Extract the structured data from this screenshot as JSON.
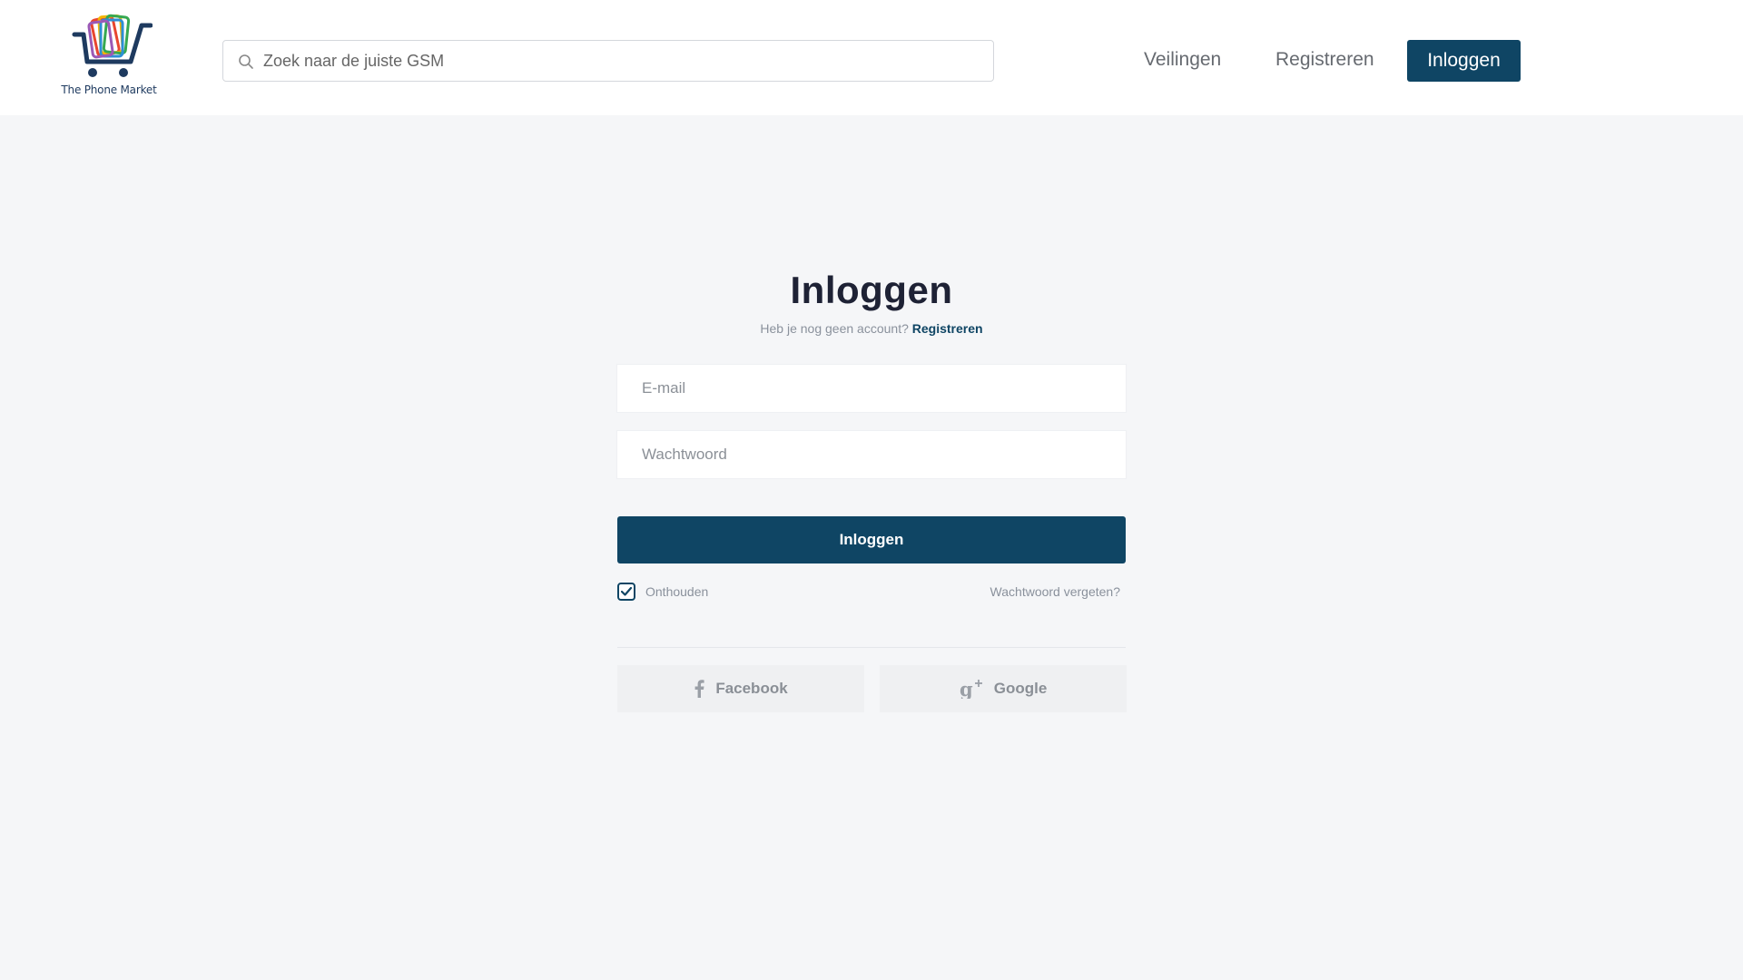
{
  "header": {
    "logo_text": "The Phone Market",
    "search_placeholder": "Zoek naar de juiste GSM",
    "nav": {
      "auctions": "Veilingen",
      "register": "Registreren",
      "login": "Inloggen"
    }
  },
  "login_form": {
    "title": "Inloggen",
    "no_account_text": "Heb je nog geen account?",
    "register_link": "Registreren",
    "email_placeholder": "E-mail",
    "password_placeholder": "Wachtwoord",
    "submit_label": "Inloggen",
    "remember_label": "Onthouden",
    "remember_checked": true,
    "forgot_password": "Wachtwoord vergeten?",
    "social": {
      "facebook": "Facebook",
      "google": "Google"
    }
  },
  "colors": {
    "primary": "#0f4564",
    "background": "#f5f6f8",
    "muted_text": "#8a919c"
  }
}
